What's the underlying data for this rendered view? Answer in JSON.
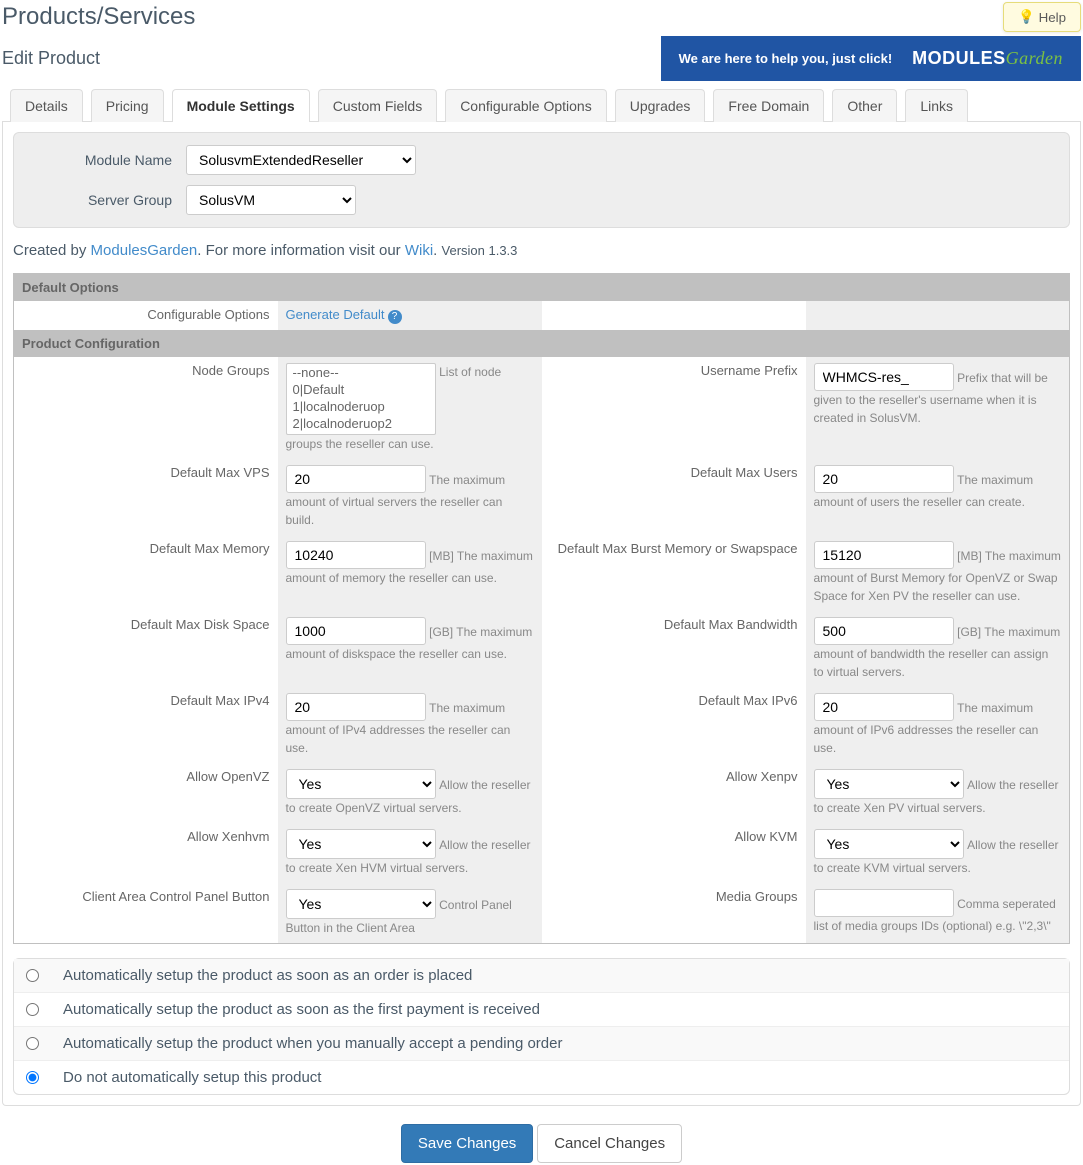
{
  "header": {
    "title": "Products/Services",
    "subtitle": "Edit Product",
    "help_label": "Help",
    "banner_text": "We are here to help you, just click!",
    "logo_main": "MODULES",
    "logo_sub": "Garden"
  },
  "tabs": [
    "Details",
    "Pricing",
    "Module Settings",
    "Custom Fields",
    "Configurable Options",
    "Upgrades",
    "Free Domain",
    "Other",
    "Links"
  ],
  "active_tab": 2,
  "module": {
    "name_label": "Module Name",
    "name_value": "SolusvmExtendedReseller",
    "group_label": "Server Group",
    "group_value": "SolusVM"
  },
  "info": {
    "created_by": "Created by ",
    "mg": "ModulesGarden",
    "more": ". For more information visit our ",
    "wiki": "Wiki",
    "dot": ". ",
    "version": "Version 1.3.3"
  },
  "sections": {
    "default_options": "Default Options",
    "product_config": "Product Configuration"
  },
  "config_opts": {
    "label": "Configurable Options",
    "link": "Generate Default"
  },
  "fields": {
    "node_groups": {
      "label": "Node Groups",
      "options": [
        "--none--",
        "0|Default",
        "1|localnoderuop",
        "2|localnoderuop2"
      ],
      "hint": "List of node groups the reseller can use."
    },
    "username_prefix": {
      "label": "Username Prefix",
      "value": "WHMCS-res_",
      "hint": "Prefix that will be given to the reseller's username when it is created in SolusVM."
    },
    "max_vps": {
      "label": "Default Max VPS",
      "value": "20",
      "hint": "The maximum amount of virtual servers the reseller can build."
    },
    "max_users": {
      "label": "Default Max Users",
      "value": "20",
      "hint": "The maximum amount of users the reseller can create."
    },
    "max_memory": {
      "label": "Default Max Memory",
      "value": "10240",
      "hint": "[MB] The maximum amount of memory the reseller can use."
    },
    "max_burst": {
      "label": "Default Max Burst Memory or Swapspace",
      "value": "15120",
      "hint": "[MB] The maximum amount of Burst Memory for OpenVZ or Swap Space for Xen PV the reseller can use."
    },
    "max_disk": {
      "label": "Default Max Disk Space",
      "value": "1000",
      "hint": "[GB] The maximum amount of diskspace the reseller can use."
    },
    "max_bw": {
      "label": "Default Max Bandwidth",
      "value": "500",
      "hint": "[GB] The maximum amount of bandwidth the reseller can assign to virtual servers."
    },
    "max_ipv4": {
      "label": "Default Max IPv4",
      "value": "20",
      "hint": "The maximum amount of IPv4 addresses the reseller can use."
    },
    "max_ipv6": {
      "label": "Default Max IPv6",
      "value": "20",
      "hint": "The maximum amount of IPv6 addresses the reseller can use."
    },
    "allow_openvz": {
      "label": "Allow OpenVZ",
      "value": "Yes",
      "hint": "Allow the reseller to create OpenVZ virtual servers."
    },
    "allow_xenpv": {
      "label": "Allow Xenpv",
      "value": "Yes",
      "hint": "Allow the reseller to create Xen PV virtual servers."
    },
    "allow_xenhvm": {
      "label": "Allow Xenhvm",
      "value": "Yes",
      "hint": "Allow the reseller to create Xen HVM virtual servers."
    },
    "allow_kvm": {
      "label": "Allow KVM",
      "value": "Yes",
      "hint": "Allow the reseller to create KVM virtual servers."
    },
    "cp_button": {
      "label": "Client Area Control Panel Button",
      "value": "Yes",
      "hint": "Control Panel Button in the Client Area"
    },
    "media_groups": {
      "label": "Media Groups",
      "value": "",
      "hint": "Comma seperated list of media groups IDs (optional) e.g. \\\"2,3\\\""
    }
  },
  "setup_options": [
    "Automatically setup the product as soon as an order is placed",
    "Automatically setup the product as soon as the first payment is received",
    "Automatically setup the product when you manually accept a pending order",
    "Do not automatically setup this product"
  ],
  "setup_selected": 3,
  "buttons": {
    "save": "Save Changes",
    "cancel": "Cancel Changes"
  }
}
